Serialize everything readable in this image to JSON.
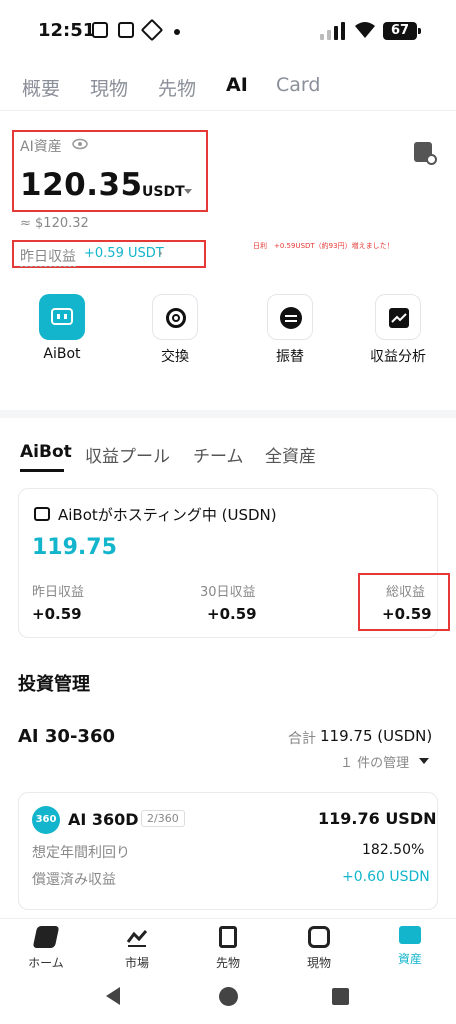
{
  "status": {
    "time": "12:51",
    "battery": "67"
  },
  "tabs": [
    "概要",
    "現物",
    "先物",
    "AI",
    "Card"
  ],
  "asset": {
    "label": "AI資産",
    "value": "120.35",
    "unit": "USDT",
    "approx": "≈ $120.32",
    "yesterday_label": "昨日収益",
    "yesterday_value": "+0.59 USDT",
    "note": "日利　+0.59USDT（約93円）増えました！"
  },
  "actions": [
    {
      "label": "AiBot",
      "icon": "robot-icon"
    },
    {
      "label": "交換",
      "icon": "exchange-icon"
    },
    {
      "label": "振替",
      "icon": "transfer-icon"
    },
    {
      "label": "収益分析",
      "icon": "chart-icon"
    }
  ],
  "sub_tabs": [
    "AiBot",
    "収益プール",
    "チーム",
    "全資産"
  ],
  "aibot_card": {
    "title": "AiBotがホスティング中 (USDN)",
    "value": "119.75",
    "stats": [
      {
        "label": "昨日収益",
        "value": "+0.59"
      },
      {
        "label": "30日収益",
        "value": "+0.59"
      },
      {
        "label": "総収益",
        "value": "+0.59"
      }
    ]
  },
  "investment": {
    "heading": "投資管理",
    "product": "AI 30-360",
    "total_label": "合計",
    "total_value": "119.75 (USDN)",
    "manage_count": "１ 件の管理",
    "item": {
      "badge": "360",
      "name": "AI 360D",
      "tag": "2/360",
      "amount": "119.76 USDN",
      "rows": [
        {
          "label": "想定年間利回り",
          "value": "182.50%"
        },
        {
          "label": "償還済み収益",
          "value": "+0.60 USDN"
        }
      ]
    }
  },
  "nav": [
    {
      "label": "ホーム",
      "icon": "home-icon"
    },
    {
      "label": "市場",
      "icon": "market-icon"
    },
    {
      "label": "先物",
      "icon": "futures-icon"
    },
    {
      "label": "現物",
      "icon": "spot-icon"
    },
    {
      "label": "資産",
      "icon": "assets-icon"
    }
  ],
  "colors": {
    "accent": "#12b5cb",
    "highlight": "#e53935"
  }
}
